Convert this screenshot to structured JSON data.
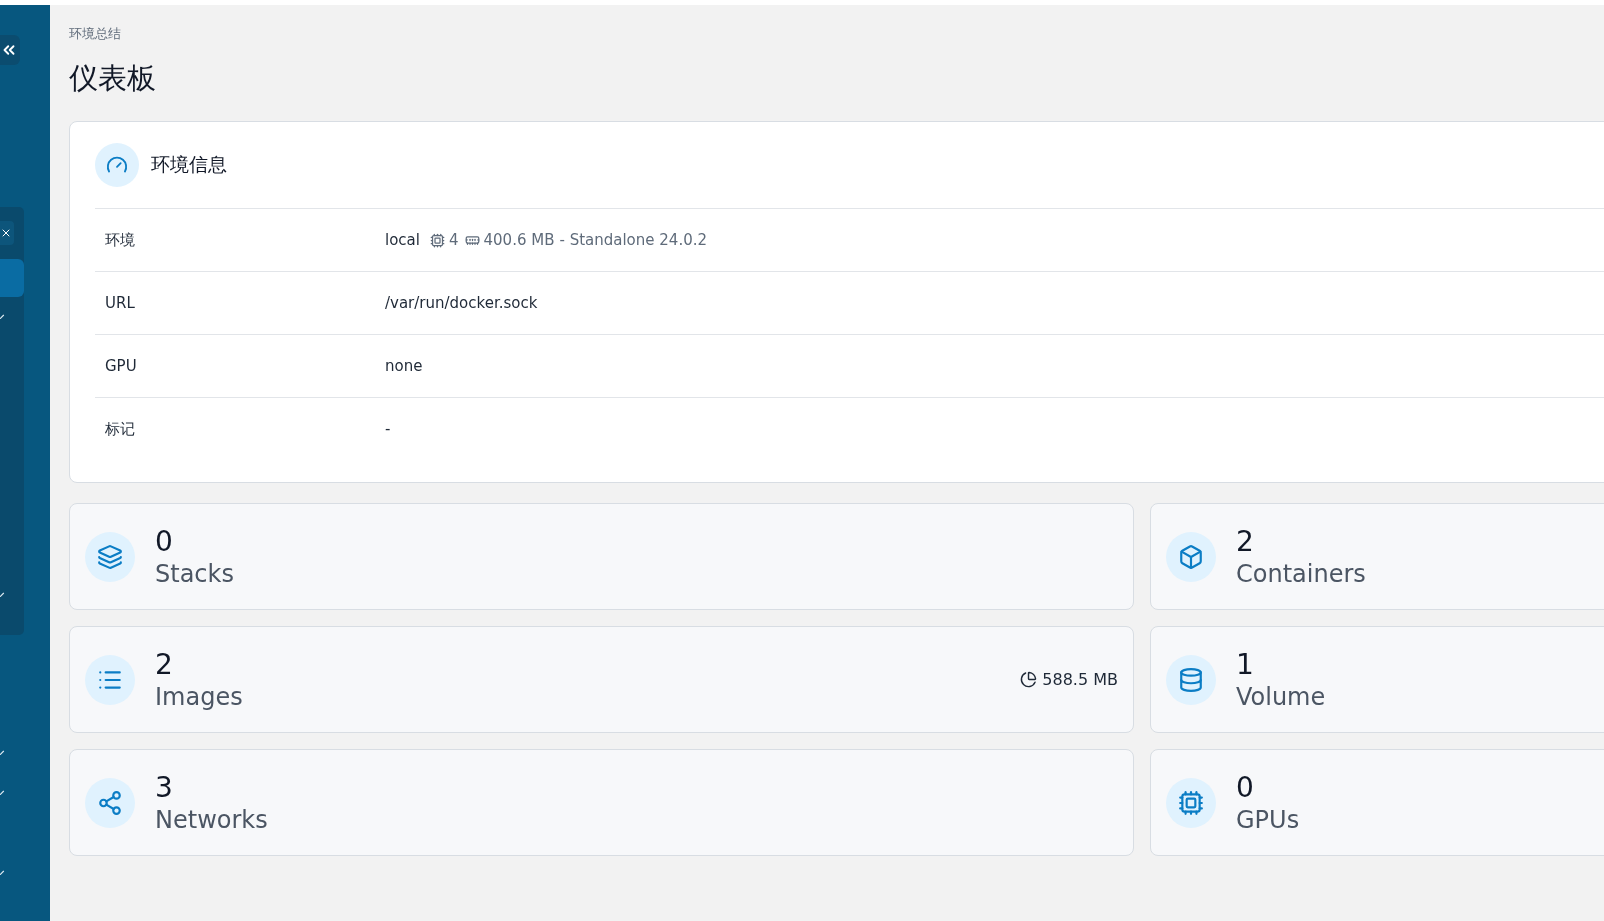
{
  "breadcrumb": "环境总结",
  "title": "仪表板",
  "environment": {
    "title": "环境信息",
    "rows": [
      {
        "label": "环境",
        "value": "local",
        "cpu": "4",
        "memory": "400.6 MB",
        "detail": "- Standalone 24.0.2"
      },
      {
        "label": "URL",
        "value": "/var/run/docker.sock"
      },
      {
        "label": "GPU",
        "value": "none"
      },
      {
        "label": "标记",
        "value": "-"
      }
    ]
  },
  "cards": [
    {
      "kind": "stacks",
      "count": "0",
      "label": "Stacks"
    },
    {
      "kind": "containers",
      "count": "2",
      "label": "Containers"
    },
    {
      "kind": "images",
      "count": "2",
      "label": "Images",
      "size": "588.5 MB"
    },
    {
      "kind": "volumes",
      "count": "1",
      "label": "Volume"
    },
    {
      "kind": "networks",
      "count": "3",
      "label": "Networks"
    },
    {
      "kind": "gpus",
      "count": "0",
      "label": "GPUs"
    }
  ]
}
